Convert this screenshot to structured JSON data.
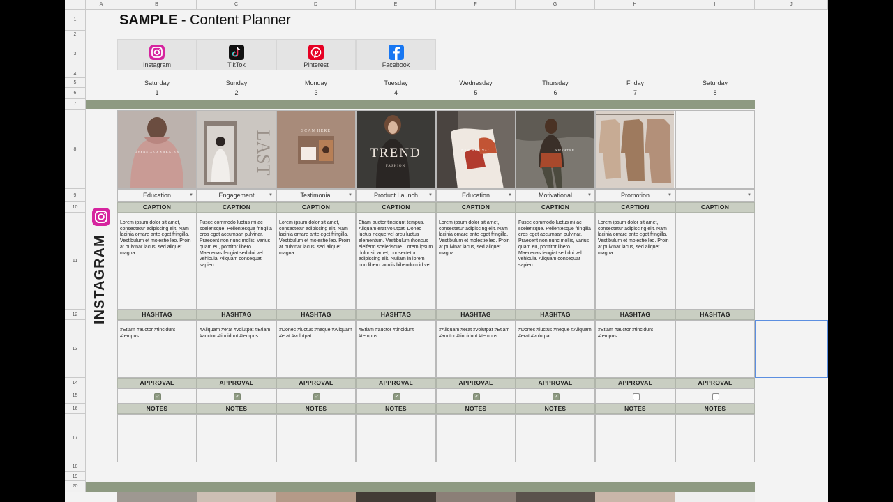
{
  "title": {
    "bold": "SAMPLE",
    "rest": " - Content Planner"
  },
  "columns": [
    "A",
    "B",
    "C",
    "D",
    "E",
    "F",
    "G",
    "H",
    "I",
    "J"
  ],
  "rows": [
    "1",
    "2",
    "3",
    "4",
    "5",
    "6",
    "7",
    "8",
    "9",
    "10",
    "11",
    "12",
    "13",
    "14",
    "15",
    "16",
    "17",
    "18",
    "19",
    "20"
  ],
  "platforms": [
    {
      "name": "Instagram",
      "icon": "instagram-icon",
      "color": "#d6249f"
    },
    {
      "name": "TikTok",
      "icon": "tiktok-icon",
      "color": "#111111"
    },
    {
      "name": "Pinterest",
      "icon": "pinterest-icon",
      "color": "#e60023"
    },
    {
      "name": "Facebook",
      "icon": "facebook-icon",
      "color": "#1877f2"
    }
  ],
  "section": {
    "name": "INSTAGRAM",
    "icon": "instagram-icon"
  },
  "labels": {
    "caption": "CAPTION",
    "hashtag": "HASHTAG",
    "approval": "APPROVAL",
    "notes": "NOTES"
  },
  "days": [
    {
      "name": "Saturday",
      "num": "1",
      "type": "Education",
      "approved": true,
      "image": {
        "kind": "sweater",
        "text": "OVERSIZED SWEATER"
      },
      "caption": "Lorem ipsum dolor sit amet, consectetur adipiscing elit. Nam lacinia ornare ante eget fringilla. Vestibulum et molestie leo. Proin at pulvinar lacus, sed aliquet magna.",
      "hashtags": "#Etiam #auctor #tincidunt #tempus"
    },
    {
      "name": "Sunday",
      "num": "2",
      "type": "Engagement",
      "approved": true,
      "image": {
        "kind": "last",
        "text": "LAST"
      },
      "caption": "Fusce commodo luctus mi ac scelerisque. Pellentesque fringilla eros eget accumsan pulvinar. Praesent non nunc mollis, varius quam eu, porttitor libero. Maecenas feugiat sed dui vel vehicula. Aliquam consequat sapien.",
      "hashtags": "#Aliquam #erat #volutpat #Etiam #auctor #tincidunt #tempus"
    },
    {
      "name": "Monday",
      "num": "3",
      "type": "Testimonial",
      "approved": true,
      "image": {
        "kind": "scan",
        "text": "SCAN HERE"
      },
      "caption": "Lorem ipsum dolor sit amet, consectetur adipiscing elit. Nam lacinia ornare ante eget fringilla. Vestibulum et molestie leo. Proin at pulvinar lacus, sed aliquet magna.",
      "hashtags": "#Donec #luctus #neque #Aliquam #erat #volutpat"
    },
    {
      "name": "Tuesday",
      "num": "4",
      "type": "Product Launch",
      "approved": true,
      "image": {
        "kind": "trend",
        "text": "TREND",
        "sub": "FASHION"
      },
      "caption": "Etiam auctor tincidunt tempus. Aliquam erat volutpat. Donec luctus neque vel arcu luctus elementum. Vestibulum rhoncus eleifend scelerisque. Lorem ipsum dolor sit amet, consectetur adipiscing elit. Nullam in lorem non libero iaculis bibendum id vel.",
      "hashtags": "#Etiam #auctor #tincidunt #tempus"
    },
    {
      "name": "Wednesday",
      "num": "5",
      "type": "Education",
      "approved": true,
      "image": {
        "kind": "arrival",
        "text": "NEW ARRIVAL"
      },
      "caption": "Lorem ipsum dolor sit amet, consectetur adipiscing elit. Nam lacinia ornare ante eget fringilla. Vestibulum et molestie leo. Proin at pulvinar lacus, sed aliquet magna.",
      "hashtags": "#Aliquam #erat #volutpat #Etiam #auctor #tincidunt #tempus"
    },
    {
      "name": "Thursday",
      "num": "6",
      "type": "Motivational",
      "approved": true,
      "image": {
        "kind": "motivate",
        "text": "SWEATER"
      },
      "caption": "Fusce commodo luctus mi ac scelerisque. Pellentesque fringilla eros eget accumsan pulvinar. Praesent non nunc mollis, varius quam eu, porttitor libero. Maecenas feugiat sed dui vel vehicula. Aliquam consequat sapien.",
      "hashtags": "#Donec #luctus #neque #Aliquam #erat #volutpat"
    },
    {
      "name": "Friday",
      "num": "7",
      "type": "Promotion",
      "approved": false,
      "image": {
        "kind": "sweaters",
        "text": ""
      },
      "caption": "Lorem ipsum dolor sit amet, consectetur adipiscing elit. Nam lacinia ornare ante eget fringilla. Vestibulum et molestie leo. Proin at pulvinar lacus, sed aliquet magna.",
      "hashtags": "#Etiam #auctor #tincidunt #tempus"
    },
    {
      "name": "Saturday",
      "num": "8",
      "type": "",
      "approved": false,
      "image": {
        "kind": "empty",
        "text": ""
      },
      "caption": "",
      "hashtags": ""
    }
  ],
  "colors": {
    "band": "#8e9a82",
    "label_bg": "#c9cec2",
    "check_on": "#8e9a82"
  }
}
